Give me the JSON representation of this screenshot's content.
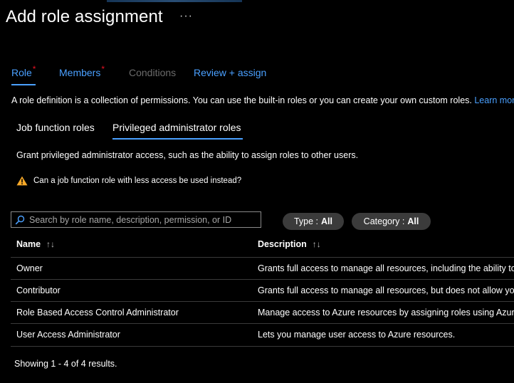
{
  "page": {
    "title": "Add role assignment",
    "more_label": "···"
  },
  "tabs": [
    {
      "label": "Role",
      "required": true
    },
    {
      "label": "Members",
      "required": true
    },
    {
      "label": "Conditions",
      "required": false
    },
    {
      "label": "Review + assign",
      "required": false
    }
  ],
  "required_marker": "*",
  "description": {
    "text": "A role definition is a collection of permissions. You can use the built-in roles or you can create your own custom roles.",
    "link": "Learn more"
  },
  "role_tabs": {
    "job_function": "Job function roles",
    "privileged": "Privileged administrator roles"
  },
  "privileged_info": "Grant privileged administrator access, such as the ability to assign roles to other users.",
  "warning": {
    "icon": "warning-icon",
    "text": "Can a job function role with less access be used instead?"
  },
  "search": {
    "placeholder": "Search by role name, description, permission, or ID",
    "value": ""
  },
  "filters": {
    "type": {
      "label": "Type :",
      "value": "All"
    },
    "category": {
      "label": "Category :",
      "value": "All"
    }
  },
  "table": {
    "headers": {
      "name": "Name",
      "description": "Description",
      "sort_icon": "↑↓"
    },
    "rows": [
      {
        "name": "Owner",
        "description": "Grants full access to manage all resources, including the ability to assign roles in Azure RBAC."
      },
      {
        "name": "Contributor",
        "description": "Grants full access to manage all resources, but does not allow you to assign roles in Azure RBAC."
      },
      {
        "name": "Role Based Access Control Administrator",
        "description": "Manage access to Azure resources by assigning roles using Azure RBAC."
      },
      {
        "name": "User Access Administrator",
        "description": "Lets you manage user access to Azure resources."
      }
    ]
  },
  "footer": "Showing 1 - 4 of 4 results.",
  "colors": {
    "background": "#000000",
    "accent": "#4aa0ff",
    "required": "#e81123",
    "pill": "#3b3b3b",
    "warning": "#f7a928"
  }
}
